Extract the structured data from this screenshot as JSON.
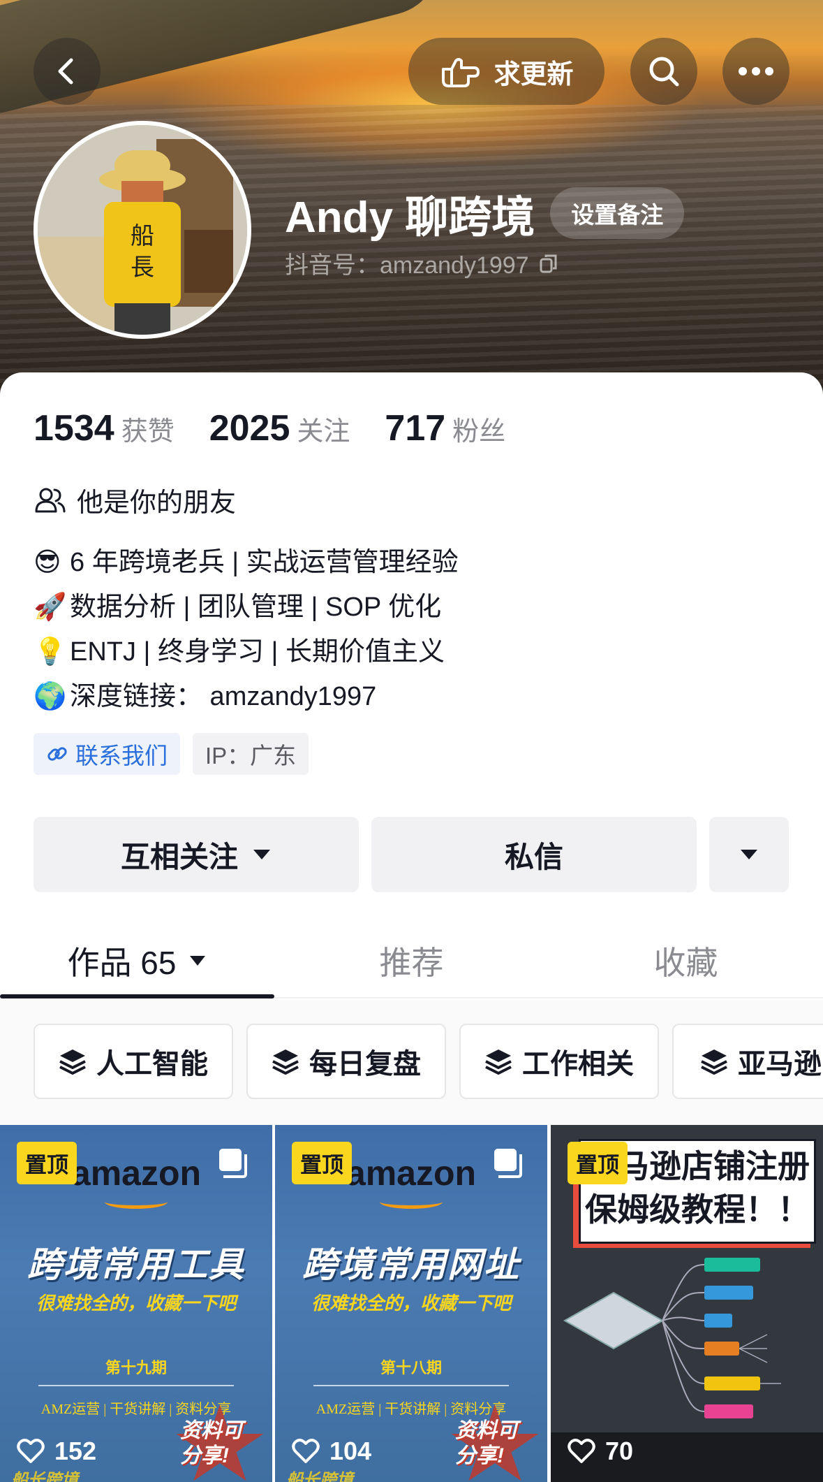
{
  "header": {
    "request_update_label": "求更新",
    "icons": [
      "back-arrow-icon",
      "hand-point-icon",
      "search-icon",
      "more-dots-icon"
    ]
  },
  "profile": {
    "name": "Andy 聊跨境",
    "remark_button": "设置备注",
    "douyin_id": "抖音号：amzandy1997"
  },
  "stats": {
    "likes": {
      "value": "1534",
      "label": "获赞"
    },
    "following": {
      "value": "2025",
      "label": "关注"
    },
    "followers": {
      "value": "717",
      "label": "粉丝"
    }
  },
  "friend_status": "他是你的朋友",
  "bio": [
    {
      "emoji": "😎",
      "text": "6 年跨境老兵 | 实战运营管理经验"
    },
    {
      "emoji": "🚀",
      "text": "数据分析 | 团队管理 | SOP 优化"
    },
    {
      "emoji": "💡",
      "text": "ENTJ | 终身学习 | 长期价值主义"
    },
    {
      "emoji": "🌍",
      "text": "深度链接： amzandy1997"
    }
  ],
  "tags": {
    "contact": "联系我们",
    "ip": "IP：广东"
  },
  "actions": {
    "follow": "互相关注",
    "message": "私信"
  },
  "tabs": {
    "works": "作品 65",
    "recommend": "推荐",
    "favorites": "收藏"
  },
  "collections": [
    "人工智能",
    "每日复盘",
    "工作相关",
    "亚马逊"
  ],
  "videos": [
    {
      "pinned": "置顶",
      "brand": "amazon",
      "title": "跨境常用工具",
      "subtitle": "很难找全的，收藏一下吧",
      "issue": "第十九期",
      "meta": "AMZ运营 | 干货讲解 | 资料分享",
      "badge_line1": "资料可",
      "badge_line2": "分享!",
      "watermark": "船长跨境",
      "likes": "152"
    },
    {
      "pinned": "置顶",
      "brand": "amazon",
      "title": "跨境常用网址",
      "subtitle": "很难找全的，收藏一下吧",
      "issue": "第十八期",
      "meta": "AMZ运营 | 干货讲解 | 资料分享",
      "badge_line1": "资料可",
      "badge_line2": "分享!",
      "watermark": "船长跨境",
      "likes": "104"
    },
    {
      "pinned": "置顶",
      "title_line1": "亚马逊店铺注册",
      "title_line2": "保姆级教程！！",
      "likes": "70"
    }
  ],
  "colors": {
    "accent_yellow": "#fbd61f",
    "link_blue": "#2a6fdb",
    "text_primary": "#161823",
    "text_secondary": "#8a8b91"
  }
}
